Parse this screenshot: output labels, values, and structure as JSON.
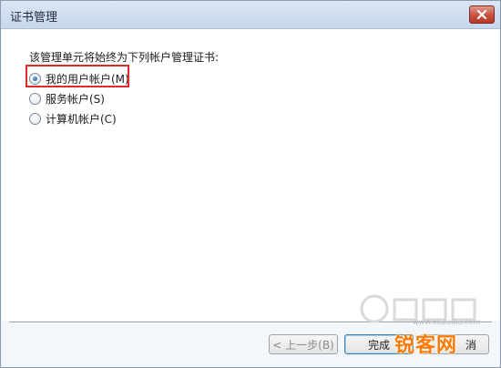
{
  "window": {
    "title": "证书管理"
  },
  "content": {
    "prompt": "该管理单元将始终为下列帐户管理证书:",
    "options": [
      {
        "label": "我的用户帐户(M)",
        "selected": true
      },
      {
        "label": "服务帐户(S)",
        "selected": false
      },
      {
        "label": "计算机帐户(C)",
        "selected": false
      }
    ]
  },
  "buttons": {
    "back": "< 上一步(B)",
    "finish": "完成",
    "cancel": "消"
  },
  "watermark": {
    "brand": "锐客网",
    "url": "www.xiazaiba.com"
  },
  "colors": {
    "highlight": "#e02a2a",
    "brand": "#ff7a00"
  }
}
